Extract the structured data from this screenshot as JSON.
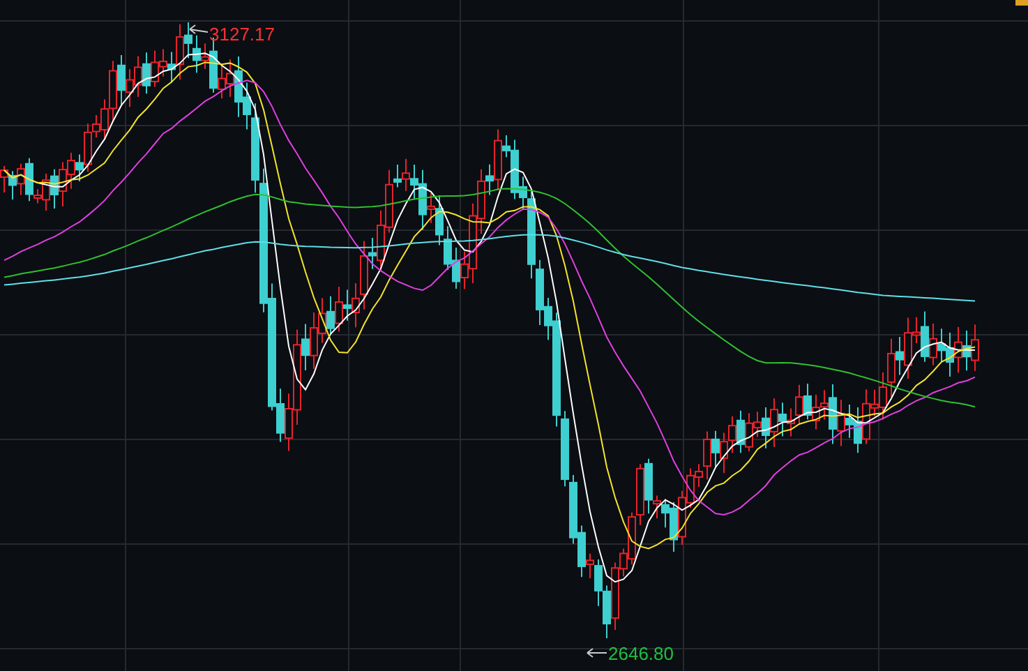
{
  "chart": {
    "high_label": "3127.17",
    "low_label": "2646.80"
  }
}
